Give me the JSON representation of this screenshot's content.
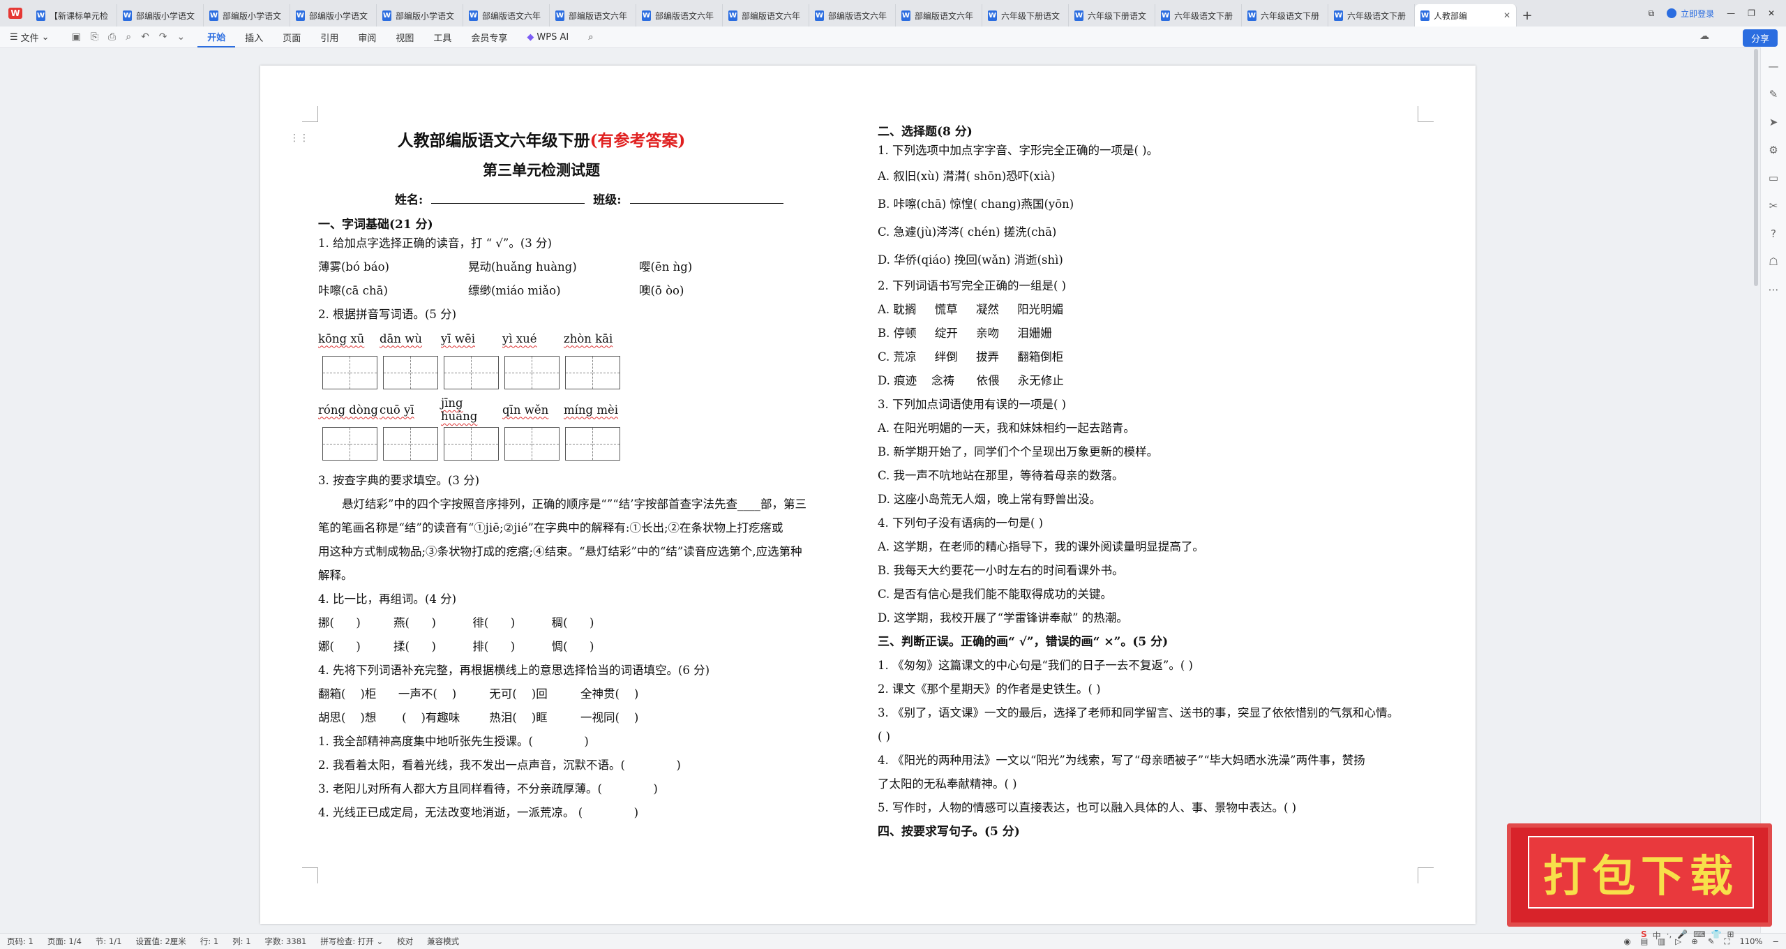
{
  "tabs": [
    {
      "label": "【新课标单元检"
    },
    {
      "label": "部编版小学语文"
    },
    {
      "label": "部编版小学语文"
    },
    {
      "label": "部编版小学语文"
    },
    {
      "label": "部编版小学语文"
    },
    {
      "label": "部编版语文六年"
    },
    {
      "label": "部编版语文六年"
    },
    {
      "label": "部编版语文六年"
    },
    {
      "label": "部编版语文六年"
    },
    {
      "label": "部编版语文六年"
    },
    {
      "label": "部编版语文六年"
    },
    {
      "label": "六年级下册语文"
    },
    {
      "label": "六年级下册语文"
    },
    {
      "label": "六年级语文下册"
    },
    {
      "label": "六年级语文下册"
    },
    {
      "label": "六年级语文下册"
    },
    {
      "label": "人教部编"
    }
  ],
  "topbar": {
    "login": "立即登录"
  },
  "ribbon": {
    "file": "文件",
    "tabs": [
      "开始",
      "插入",
      "页面",
      "引用",
      "审阅",
      "视图",
      "工具",
      "会员专享"
    ],
    "ai": "WPS AI",
    "share": "分享"
  },
  "doc": {
    "title_main": "人教部编版语文六年级下册",
    "title_red": "(有参考答案)",
    "subtitle": "第三单元检测试题",
    "name_label": "姓名:",
    "class_label": "班级:",
    "left": {
      "s1": "一、字词基础(21 分)",
      "q1": "1. 给加点字选择正确的读音，打 “ √”。(3 分)",
      "q1_r1": [
        "薄雾(bó  báo)",
        "晃动(huǎng  huàng)",
        "嘤(ēn  ǹg)"
      ],
      "q1_r2": [
        "咔嚓(cā  chā)",
        "缥缈(miáo  miǎo)",
        "噢(ō  òo)"
      ],
      "q2": "2. 根据拼音写词语。(5 分)",
      "py1": [
        "kōng  xū",
        "dān  wù",
        "yī  wēi",
        "yì  xué",
        "zhòn  kāi"
      ],
      "py2": [
        "róng  dòng",
        "cuō  yī",
        "jīng huáng",
        "qīn  wěn",
        "míng  mèi"
      ],
      "q3": "3. 按查字典的要求填空。(3 分)",
      "q3_p1": "悬灯结彩”中的四个字按照音序排列，正确的顺序是“”“结’字按部首查字法先查____部，第三",
      "q3_p2": "笔的笔画名称是“结”的读音有“①jiē;②jié”在字典中的解释有:①长出;②在条状物上打疙瘩或",
      "q3_p3": "用这种方式制成物品;③条状物打成的疙瘩;④结束。“悬灯结彩”中的“结”读音应选第个,应选第种",
      "q3_p4": "解释。",
      "q4": "4. 比一比，再组词。(4 分)",
      "q4_r1": "挪(      )         燕(      )          徘(      )          稠(      )",
      "q4_r2": "娜(      )         揉(      )          排(      )          惆(      )",
      "q5": "4. 先将下列词语补充完整，再根据横线上的意思选择恰当的词语填空。(6 分)",
      "q5_r1": "翻箱(    )柜      一声不(    )         无可(    )回         全神贯(    )",
      "q5_r2": "胡思(    )想       (    )有趣味        热泪(    )眶         一视同(    )",
      "q5_s1": "1. 我全部精神高度集中地听张先生授课。(              )",
      "q5_s2": "2. 我看着太阳，看着光线，我不发出一点声音，沉默不语。(              )",
      "q5_s3": "3. 老阳儿对所有人都大方且同样看待，不分亲疏厚薄。(              )",
      "q5_s4": "4. 光线正已成定局，无法改变地消逝，一派荒凉。 (              )"
    },
    "right": {
      "s2": "二、选择题(8 分)",
      "c1": "1. 下列选项中加点字字音、字形完全正确的一项是(     )。",
      "c1a": "A. 叙旧(xù)   潸潸( shōn)恐吓(xià)",
      "c1b": "B. 咔嚓(chā)     惊惶( chang)燕国(yōn)",
      "c1c": "C. 急遽(jù)涔涔( chén)   搓洗(chā)",
      "c1d": "D. 华侨(qiáo) 挽回(wǎn)     消逝(shì)",
      "c2": "2. 下列词语书写完全正确的一组是(      )",
      "c2a": "A. 耽搁     慌草     凝然     阳光明媚",
      "c2b": "B. 停顿     绽开     亲吻     泪姗姗",
      "c2c": "C. 荒凉     绊倒     拔弄     翻箱倒柜",
      "c2d": "D. 痕迹    念祷      依偎     永无修止",
      "c3": "3. 下列加点词语使用有误的一项是(      )",
      "c3a": "A. 在阳光明媚的一天，我和妹妹相约一起去踏青。",
      "c3b": "B. 新学期开始了，同学们个个呈现出万象更新的模样。",
      "c3c": "C. 我一声不吭地站在那里，等待着母亲的数落。",
      "c3d": "D. 这座小岛荒无人烟，晚上常有野兽出没。",
      "c4": "4. 下列句子没有语病的一句是(      )",
      "c4a": "A. 这学期，在老师的精心指导下，我的课外阅读量明显提高了。",
      "c4b": "B. 我每天大约要花一小时左右的时间看课外书。",
      "c4c": "C. 是否有信心是我们能不能取得成功的关键。",
      "c4d": "D. 这学期，我校开展了“学雷锋讲奉献” 的热潮。",
      "s3": "三、判断正误。正确的画“ √”，错误的画“ ×”。(5 分)",
      "j1": "1. 《匆匆》这篇课文的中心句是“我们的日子一去不复返”。(      )",
      "j2": "2. 课文《那个星期天》的作者是史铁生。(      )",
      "j3": "3. 《别了，语文课》一文的最后，选择了老师和同学留言、送书的事，突显了依依惜别的气氛和心情。",
      "j3b": "(      )",
      "j4": "4. 《阳光的两种用法》一文以“阳光”为线索，写了“母亲晒被子”“毕大妈晒水洗澡”两件事，赞扬",
      "j4b": "了太阳的无私奉献精神。(      )",
      "j5": "5. 写作时，人物的情感可以直接表达，也可以融入具体的人、事、景物中表达。(      )",
      "s4": "四、按要求写句子。(5 分)"
    }
  },
  "status": {
    "page": "页码: 1",
    "pages": "页面: 1/4",
    "section": "节: 1/1",
    "setting": "设置值: 2厘米",
    "row": "行: 1",
    "col": "列: 1",
    "words": "字数: 3381",
    "spell": "拼写检查: 打开",
    "proof": "校对",
    "compat": "兼容模式",
    "zoom": "110%"
  },
  "overlay": {
    "download": "打包下载"
  },
  "ime": [
    "中",
    "·,",
    "🎤",
    "⌨",
    "👕",
    "⊞"
  ]
}
